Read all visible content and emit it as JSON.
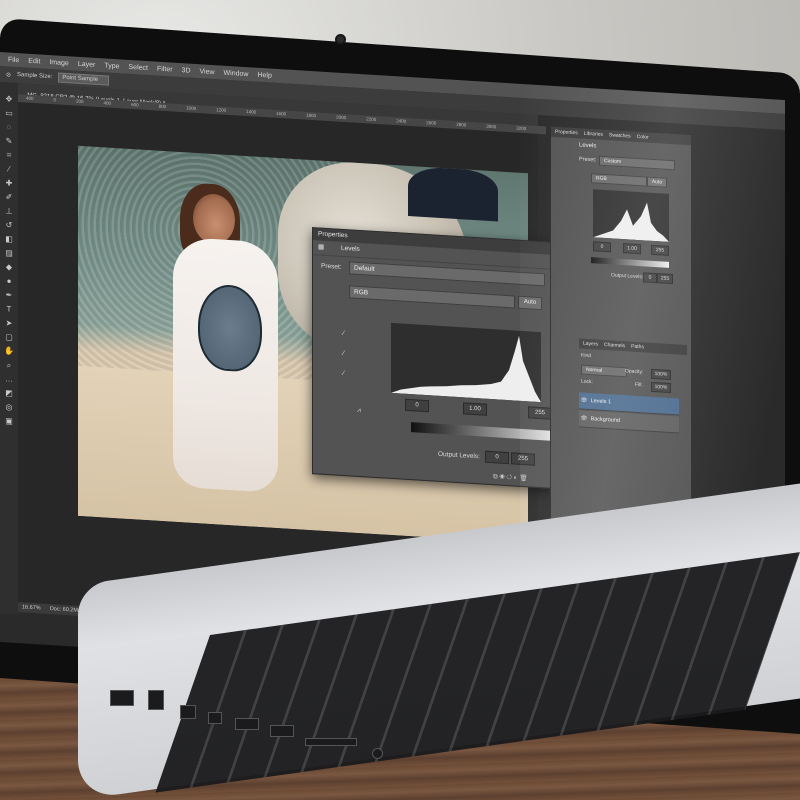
{
  "app": {
    "menu": [
      "File",
      "Edit",
      "Image",
      "Layer",
      "Type",
      "Select",
      "Filter",
      "3D",
      "View",
      "Window",
      "Help"
    ],
    "options": {
      "label": "Sample Size:",
      "value": "Point Sample"
    },
    "doc_tab": "_MG_8218.CR2 @ 16.7% (Levels 1, Layer Mask/8) *",
    "ruler_ticks": [
      "400",
      "0",
      "200",
      "400",
      "600",
      "800",
      "1000",
      "1200",
      "1400",
      "1600",
      "1800",
      "2000",
      "2200",
      "2400",
      "2600",
      "2800",
      "3000",
      "3200",
      "3400",
      "3600",
      "3800",
      "4000",
      "4200",
      "4400",
      "4600",
      "4800",
      "5000",
      "5200"
    ],
    "status": {
      "zoom": "16.67%",
      "doc": "Doc: 60.2M/60.2M"
    }
  },
  "properties_panel": {
    "header": "Properties",
    "title": "Levels",
    "preset_label": "Preset:",
    "preset_value": "Default",
    "channel": "RGB",
    "auto_label": "Auto",
    "input_values": [
      "0",
      "1.00",
      "255"
    ],
    "output_label": "Output Levels:",
    "output_values": [
      "0",
      "255"
    ]
  },
  "right_panel": {
    "tabs": [
      "Properties",
      "Libraries",
      "Swatches",
      "Color"
    ],
    "title": "Levels",
    "preset_label": "Preset:",
    "preset_value": "Custom",
    "channel": "RGB",
    "auto_label": "Auto",
    "input_values": [
      "0",
      "1.00",
      "255"
    ],
    "output_label": "Output Levels:",
    "output_values": [
      "0",
      "255"
    ],
    "layer_tabs": [
      "Layers",
      "Channels",
      "Paths"
    ],
    "blend_mode": "Normal",
    "opacity_label": "Opacity:",
    "opacity_value": "100%",
    "lock_label": "Lock:",
    "fill_label": "Fill:",
    "fill_value": "100%",
    "kind_label": "Kind",
    "layers": [
      {
        "name": "Levels 1",
        "active": true
      },
      {
        "name": "Background",
        "active": false
      }
    ]
  },
  "colors": {
    "ps_dark": "#2a2a2a",
    "ps_panel": "#535353",
    "ps_highlight": "#4b6b8f"
  }
}
